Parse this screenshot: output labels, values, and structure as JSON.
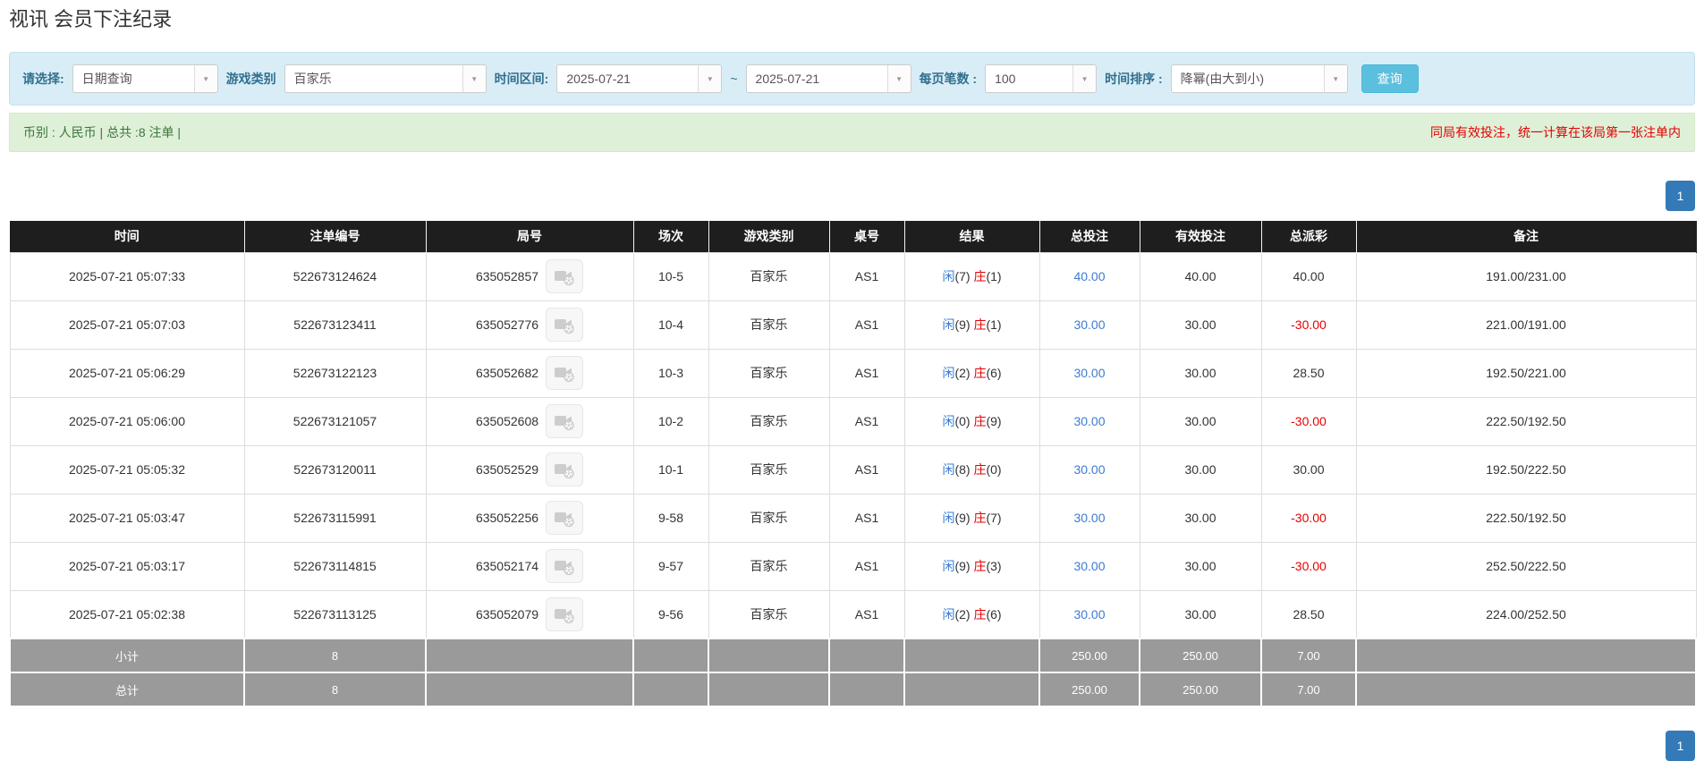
{
  "page": {
    "title": "视讯 会员下注纪录"
  },
  "icons": {
    "combo_arrow": "▼"
  },
  "filters": {
    "select_label": "请选择:",
    "select_value": "日期查询",
    "game_label": "游戏类别",
    "game_value": "百家乐",
    "range_label": "时间区间:",
    "date_from": "2025-07-21",
    "range_separator": "~",
    "date_to": "2025-07-21",
    "page_size_label": "每页笔数 :",
    "page_size_value": "100",
    "sort_label": "时间排序 :",
    "sort_value": "降幂(由大到小)",
    "search_button": "查询"
  },
  "summary_bar": {
    "left_text": "币别 : 人民币 | 总共 :8 注单 |",
    "right_text": "同局有效投注，统一计算在该局第一张注单内"
  },
  "pagination": {
    "current_page": "1"
  },
  "table": {
    "columns": [
      "时间",
      "注单编号",
      "局号",
      "场次",
      "游戏类别",
      "桌号",
      "结果",
      "总投注",
      "有效投注",
      "总派彩",
      "备注"
    ],
    "result_labels": {
      "player": "闲",
      "banker": "庄"
    },
    "rows": [
      {
        "time": "2025-07-21 05:07:33",
        "bet_id": "522673124624",
        "round_id": "635052857",
        "session": "10-5",
        "game": "百家乐",
        "table_no": "AS1",
        "player": "7",
        "banker": "1",
        "total_bet": "40.00",
        "valid_bet": "40.00",
        "payout": "40.00",
        "payout_negative": false,
        "remark": "191.00/231.00"
      },
      {
        "time": "2025-07-21 05:07:03",
        "bet_id": "522673123411",
        "round_id": "635052776",
        "session": "10-4",
        "game": "百家乐",
        "table_no": "AS1",
        "player": "9",
        "banker": "1",
        "total_bet": "30.00",
        "valid_bet": "30.00",
        "payout": "-30.00",
        "payout_negative": true,
        "remark": "221.00/191.00"
      },
      {
        "time": "2025-07-21 05:06:29",
        "bet_id": "522673122123",
        "round_id": "635052682",
        "session": "10-3",
        "game": "百家乐",
        "table_no": "AS1",
        "player": "2",
        "banker": "6",
        "total_bet": "30.00",
        "valid_bet": "30.00",
        "payout": "28.50",
        "payout_negative": false,
        "remark": "192.50/221.00"
      },
      {
        "time": "2025-07-21 05:06:00",
        "bet_id": "522673121057",
        "round_id": "635052608",
        "session": "10-2",
        "game": "百家乐",
        "table_no": "AS1",
        "player": "0",
        "banker": "9",
        "total_bet": "30.00",
        "valid_bet": "30.00",
        "payout": "-30.00",
        "payout_negative": true,
        "remark": "222.50/192.50"
      },
      {
        "time": "2025-07-21 05:05:32",
        "bet_id": "522673120011",
        "round_id": "635052529",
        "session": "10-1",
        "game": "百家乐",
        "table_no": "AS1",
        "player": "8",
        "banker": "0",
        "total_bet": "30.00",
        "valid_bet": "30.00",
        "payout": "30.00",
        "payout_negative": false,
        "remark": "192.50/222.50"
      },
      {
        "time": "2025-07-21 05:03:47",
        "bet_id": "522673115991",
        "round_id": "635052256",
        "session": "9-58",
        "game": "百家乐",
        "table_no": "AS1",
        "player": "9",
        "banker": "7",
        "total_bet": "30.00",
        "valid_bet": "30.00",
        "payout": "-30.00",
        "payout_negative": true,
        "remark": "222.50/192.50"
      },
      {
        "time": "2025-07-21 05:03:17",
        "bet_id": "522673114815",
        "round_id": "635052174",
        "session": "9-57",
        "game": "百家乐",
        "table_no": "AS1",
        "player": "9",
        "banker": "3",
        "total_bet": "30.00",
        "valid_bet": "30.00",
        "payout": "-30.00",
        "payout_negative": true,
        "remark": "252.50/222.50"
      },
      {
        "time": "2025-07-21 05:02:38",
        "bet_id": "522673113125",
        "round_id": "635052079",
        "session": "9-56",
        "game": "百家乐",
        "table_no": "AS1",
        "player": "2",
        "banker": "6",
        "total_bet": "30.00",
        "valid_bet": "30.00",
        "payout": "28.50",
        "payout_negative": false,
        "remark": "224.00/252.50"
      }
    ],
    "subtotal": {
      "label": "小计",
      "count": "8",
      "total_bet": "250.00",
      "valid_bet": "250.00",
      "payout": "7.00"
    },
    "grand_total": {
      "label": "总计",
      "count": "8",
      "total_bet": "250.00",
      "valid_bet": "250.00",
      "payout": "7.00"
    }
  },
  "colors": {
    "filter_bg": "#d9edf7",
    "search_button_blue": "#5bc0de",
    "summary_green_bg": "#dff0d8",
    "summary_green_text": "#3c763d",
    "notice_red": "#e60000",
    "link_blue": "#3a7bd5",
    "pagination_blue": "#337ab7",
    "table_header_black": "#1e1e1e",
    "totals_gray": "#9a9a9a"
  }
}
